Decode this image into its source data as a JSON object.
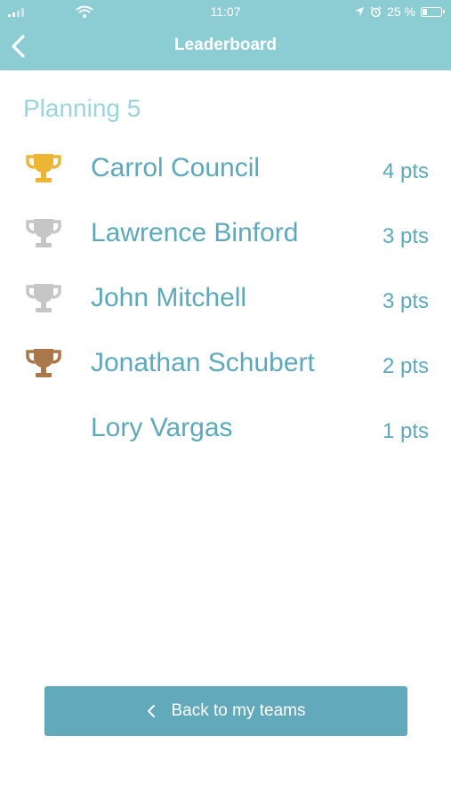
{
  "status_bar": {
    "time": "11:07",
    "battery": "25 %",
    "battery_level": 0.25,
    "icons": [
      "signal-icon",
      "wifi-icon",
      "location-icon",
      "alarm-icon",
      "battery-icon"
    ]
  },
  "header": {
    "title": "Leaderboard",
    "back_icon": "chevron-left-icon"
  },
  "leaderboard": {
    "team": "Planning 5",
    "entries": [
      {
        "name": "Carrol Council",
        "points": "4 pts",
        "trophy": "gold-trophy-icon"
      },
      {
        "name": "Lawrence Binford",
        "points": "3 pts",
        "trophy": "silver-trophy-icon"
      },
      {
        "name": "John Mitchell",
        "points": "3 pts",
        "trophy": "silver-trophy-icon"
      },
      {
        "name": "Jonathan Schubert",
        "points": "2 pts",
        "trophy": "bronze-trophy-icon"
      },
      {
        "name": "Lory Vargas",
        "points": "1 pts",
        "trophy": ""
      }
    ]
  },
  "footer": {
    "back_label": "Back to my teams"
  },
  "colors": {
    "header_bg": "#8ccdd4",
    "accent_text": "#5ea9b9",
    "section_title": "#9ad4dc",
    "button_bg": "#62aabb",
    "gold": "#edb534",
    "silver": "#c6c6c6",
    "bronze": "#a9774a"
  }
}
